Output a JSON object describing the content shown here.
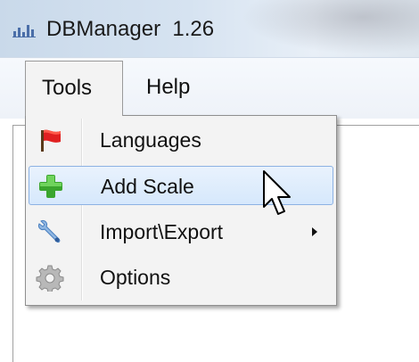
{
  "window": {
    "title": "DBManager  1.26",
    "icon": "db-bars-icon"
  },
  "menubar": {
    "items": [
      {
        "label": "Tools",
        "active": true
      },
      {
        "label": "Help",
        "active": false
      }
    ]
  },
  "tools_menu": {
    "items": [
      {
        "label": "Languages",
        "icon": "red-flag-icon",
        "highlighted": false,
        "has_submenu": false
      },
      {
        "label": "Add Scale",
        "icon": "green-plus-icon",
        "highlighted": true,
        "has_submenu": false
      },
      {
        "label": "Import\\Export",
        "icon": "wrench-icon",
        "highlighted": false,
        "has_submenu": true
      },
      {
        "label": "Options",
        "icon": "gear-icon",
        "highlighted": false,
        "has_submenu": false
      }
    ]
  },
  "colors": {
    "highlight_border": "#8db2e3",
    "highlight_fill": "#d6e8fc",
    "menu_background": "#f3f3f3"
  }
}
